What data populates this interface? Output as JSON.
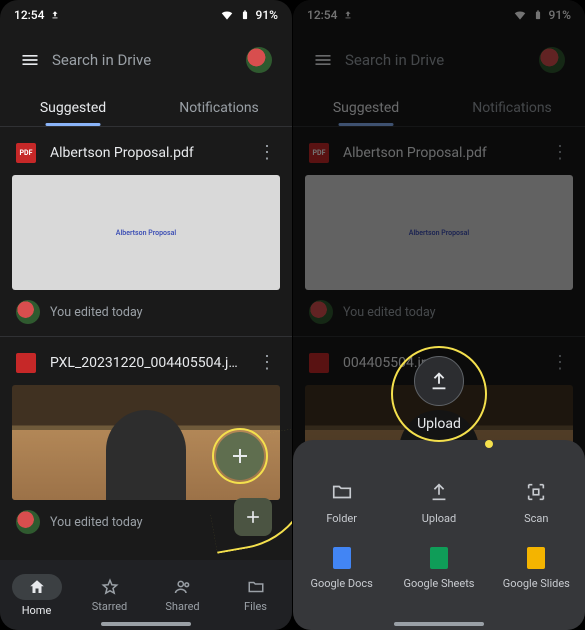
{
  "status": {
    "time": "12:54",
    "battery": "91%"
  },
  "search": {
    "placeholder": "Search in Drive"
  },
  "tabs": {
    "suggested": "Suggested",
    "notifications": "Notifications"
  },
  "files": {
    "f1": {
      "name": "Albertson Proposal.pdf",
      "thumb_caption": "Albertson Proposal",
      "meta": "You edited today"
    },
    "f2": {
      "name": "PXL_20231220_004405504.jpg",
      "name_short": "004405504.jpg",
      "meta": "You edited today"
    }
  },
  "nav": {
    "home": "Home",
    "starred": "Starred",
    "shared": "Shared",
    "files": "Files"
  },
  "sheet": {
    "upload_label": "Upload",
    "items": {
      "folder": "Folder",
      "upload": "Upload",
      "scan": "Scan",
      "docs": "Google Docs",
      "sheets": "Google Sheets",
      "slides": "Google Slides"
    }
  }
}
